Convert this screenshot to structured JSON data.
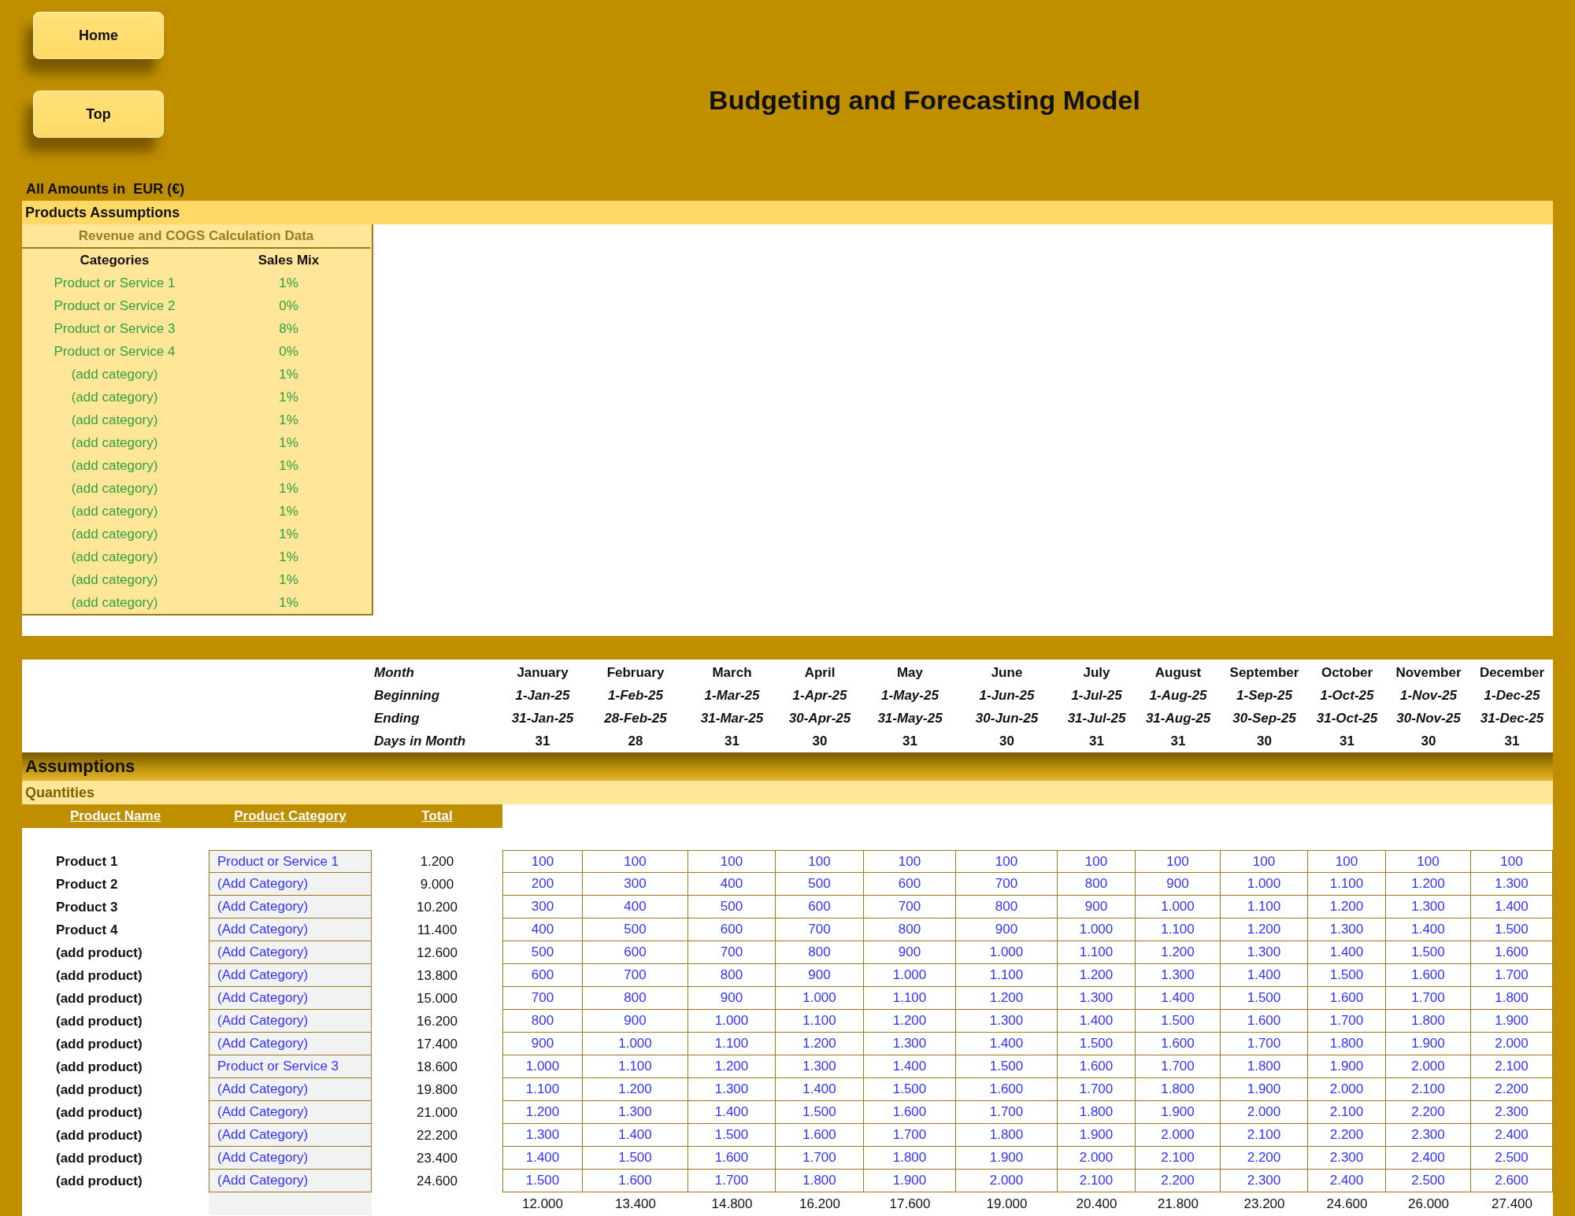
{
  "buttons": [
    {
      "label": "Home"
    },
    {
      "label": "Top"
    }
  ],
  "title": "Budgeting and Forecasting Model",
  "currency_note": "All Amounts in  EUR (€)",
  "products_assumptions": {
    "heading": "Products Assumptions",
    "table": {
      "title": "Revenue and COGS Calculation Data",
      "columns": [
        "Categories",
        "Sales Mix"
      ],
      "rows": [
        {
          "category": "Product or Service 1",
          "sales_mix": "1%"
        },
        {
          "category": "Product or Service 2",
          "sales_mix": "0%"
        },
        {
          "category": "Product or Service 3",
          "sales_mix": "8%"
        },
        {
          "category": "Product or Service 4",
          "sales_mix": "0%"
        },
        {
          "category": "(add category)",
          "sales_mix": "1%"
        },
        {
          "category": "(add category)",
          "sales_mix": "1%"
        },
        {
          "category": "(add category)",
          "sales_mix": "1%"
        },
        {
          "category": "(add category)",
          "sales_mix": "1%"
        },
        {
          "category": "(add category)",
          "sales_mix": "1%"
        },
        {
          "category": "(add category)",
          "sales_mix": "1%"
        },
        {
          "category": "(add category)",
          "sales_mix": "1%"
        },
        {
          "category": "(add category)",
          "sales_mix": "1%"
        },
        {
          "category": "(add category)",
          "sales_mix": "1%"
        },
        {
          "category": "(add category)",
          "sales_mix": "1%"
        },
        {
          "category": "(add category)",
          "sales_mix": "1%"
        }
      ]
    }
  },
  "timeline": {
    "labels": [
      "Month",
      "Beginning",
      "Ending",
      "Days in Month"
    ],
    "months": [
      {
        "month": "January",
        "beginning": "1-Jan-25",
        "ending": "31-Jan-25",
        "days": "31"
      },
      {
        "month": "February",
        "beginning": "1-Feb-25",
        "ending": "28-Feb-25",
        "days": "28"
      },
      {
        "month": "March",
        "beginning": "1-Mar-25",
        "ending": "31-Mar-25",
        "days": "31"
      },
      {
        "month": "April",
        "beginning": "1-Apr-25",
        "ending": "30-Apr-25",
        "days": "30"
      },
      {
        "month": "May",
        "beginning": "1-May-25",
        "ending": "31-May-25",
        "days": "31"
      },
      {
        "month": "June",
        "beginning": "1-Jun-25",
        "ending": "30-Jun-25",
        "days": "30"
      },
      {
        "month": "July",
        "beginning": "1-Jul-25",
        "ending": "31-Jul-25",
        "days": "31"
      },
      {
        "month": "August",
        "beginning": "1-Aug-25",
        "ending": "31-Aug-25",
        "days": "31"
      },
      {
        "month": "September",
        "beginning": "1-Sep-25",
        "ending": "30-Sep-25",
        "days": "30"
      },
      {
        "month": "October",
        "beginning": "1-Oct-25",
        "ending": "31-Oct-25",
        "days": "31"
      },
      {
        "month": "November",
        "beginning": "1-Nov-25",
        "ending": "30-Nov-25",
        "days": "30"
      },
      {
        "month": "December",
        "beginning": "1-Dec-25",
        "ending": "31-Dec-25",
        "days": "31"
      }
    ]
  },
  "assumptions": {
    "heading": "Assumptions",
    "subheading": "Quantities",
    "columns": [
      "Product Name",
      "Product Category",
      "Total"
    ],
    "rows": [
      {
        "product": "Product 1",
        "category": "Product or Service 1",
        "total": "1.200",
        "values": [
          "100",
          "100",
          "100",
          "100",
          "100",
          "100",
          "100",
          "100",
          "100",
          "100",
          "100",
          "100"
        ]
      },
      {
        "product": "Product 2",
        "category": "(Add Category)",
        "total": "9.000",
        "values": [
          "200",
          "300",
          "400",
          "500",
          "600",
          "700",
          "800",
          "900",
          "1.000",
          "1.100",
          "1.200",
          "1.300"
        ]
      },
      {
        "product": "Product 3",
        "category": "(Add Category)",
        "total": "10.200",
        "values": [
          "300",
          "400",
          "500",
          "600",
          "700",
          "800",
          "900",
          "1.000",
          "1.100",
          "1.200",
          "1.300",
          "1.400"
        ]
      },
      {
        "product": "Product 4",
        "category": "(Add Category)",
        "total": "11.400",
        "values": [
          "400",
          "500",
          "600",
          "700",
          "800",
          "900",
          "1.000",
          "1.100",
          "1.200",
          "1.300",
          "1.400",
          "1.500"
        ]
      },
      {
        "product": "(add product)",
        "category": "(Add Category)",
        "total": "12.600",
        "values": [
          "500",
          "600",
          "700",
          "800",
          "900",
          "1.000",
          "1.100",
          "1.200",
          "1.300",
          "1.400",
          "1.500",
          "1.600"
        ]
      },
      {
        "product": "(add product)",
        "category": "(Add Category)",
        "total": "13.800",
        "values": [
          "600",
          "700",
          "800",
          "900",
          "1.000",
          "1.100",
          "1.200",
          "1.300",
          "1.400",
          "1.500",
          "1.600",
          "1.700"
        ]
      },
      {
        "product": "(add product)",
        "category": "(Add Category)",
        "total": "15.000",
        "values": [
          "700",
          "800",
          "900",
          "1.000",
          "1.100",
          "1.200",
          "1.300",
          "1.400",
          "1.500",
          "1.600",
          "1.700",
          "1.800"
        ]
      },
      {
        "product": "(add product)",
        "category": "(Add Category)",
        "total": "16.200",
        "values": [
          "800",
          "900",
          "1.000",
          "1.100",
          "1.200",
          "1.300",
          "1.400",
          "1.500",
          "1.600",
          "1.700",
          "1.800",
          "1.900"
        ]
      },
      {
        "product": "(add product)",
        "category": "(Add Category)",
        "total": "17.400",
        "values": [
          "900",
          "1.000",
          "1.100",
          "1.200",
          "1.300",
          "1.400",
          "1.500",
          "1.600",
          "1.700",
          "1.800",
          "1.900",
          "2.000"
        ]
      },
      {
        "product": "(add product)",
        "category": "Product or Service 3",
        "total": "18.600",
        "values": [
          "1.000",
          "1.100",
          "1.200",
          "1.300",
          "1.400",
          "1.500",
          "1.600",
          "1.700",
          "1.800",
          "1.900",
          "2.000",
          "2.100"
        ]
      },
      {
        "product": "(add product)",
        "category": "(Add Category)",
        "total": "19.800",
        "values": [
          "1.100",
          "1.200",
          "1.300",
          "1.400",
          "1.500",
          "1.600",
          "1.700",
          "1.800",
          "1.900",
          "2.000",
          "2.100",
          "2.200"
        ]
      },
      {
        "product": "(add product)",
        "category": "(Add Category)",
        "total": "21.000",
        "values": [
          "1.200",
          "1.300",
          "1.400",
          "1.500",
          "1.600",
          "1.700",
          "1.800",
          "1.900",
          "2.000",
          "2.100",
          "2.200",
          "2.300"
        ]
      },
      {
        "product": "(add product)",
        "category": "(Add Category)",
        "total": "22.200",
        "values": [
          "1.300",
          "1.400",
          "1.500",
          "1.600",
          "1.700",
          "1.800",
          "1.900",
          "2.000",
          "2.100",
          "2.200",
          "2.300",
          "2.400"
        ]
      },
      {
        "product": "(add product)",
        "category": "(Add Category)",
        "total": "23.400",
        "values": [
          "1.400",
          "1.500",
          "1.600",
          "1.700",
          "1.800",
          "1.900",
          "2.000",
          "2.100",
          "2.200",
          "2.300",
          "2.400",
          "2.500"
        ]
      },
      {
        "product": "(add product)",
        "category": "(Add Category)",
        "total": "24.600",
        "values": [
          "1.500",
          "1.600",
          "1.700",
          "1.800",
          "1.900",
          "2.000",
          "2.100",
          "2.200",
          "2.300",
          "2.400",
          "2.500",
          "2.600"
        ]
      }
    ],
    "column_totals": [
      "12.000",
      "13.400",
      "14.800",
      "16.200",
      "17.600",
      "19.000",
      "20.400",
      "21.800",
      "23.200",
      "24.600",
      "26.000",
      "27.400"
    ]
  }
}
